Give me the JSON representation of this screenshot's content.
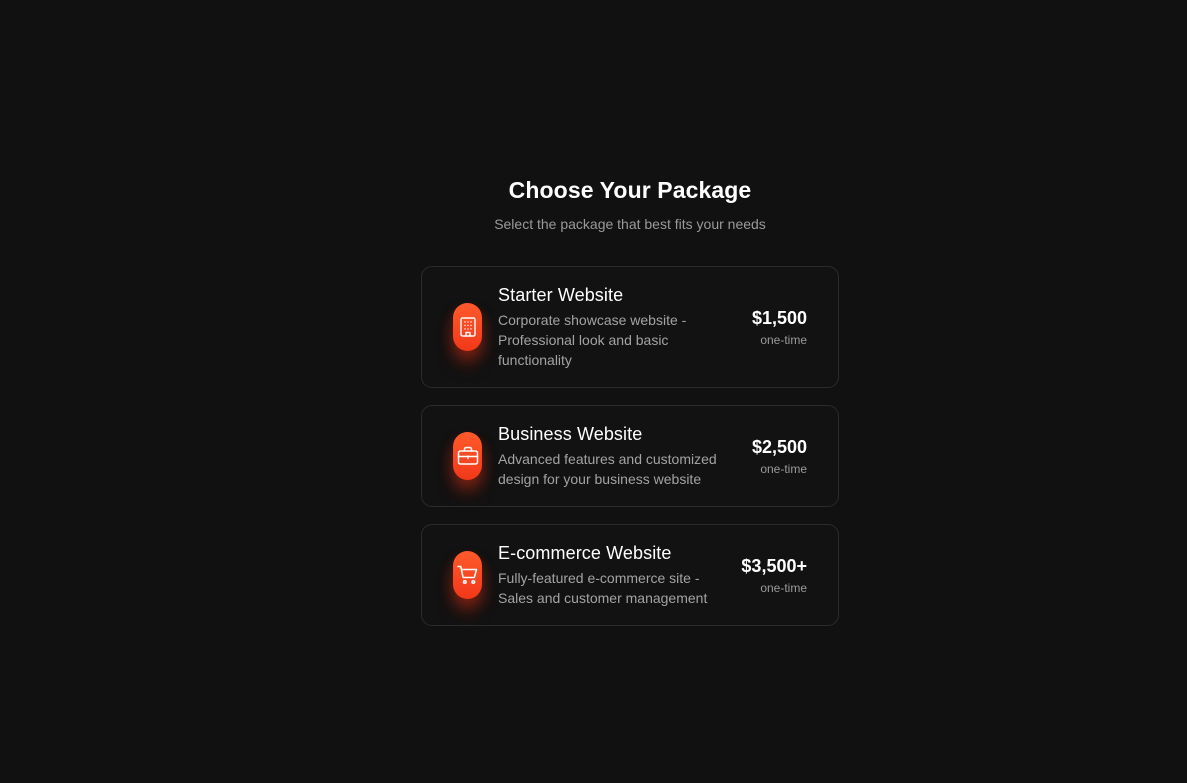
{
  "header": {
    "title": "Choose Your Package",
    "subtitle": "Select the package that best fits your needs"
  },
  "packages": [
    {
      "icon": "building-icon",
      "name": "Starter Website",
      "description": "Corporate showcase website - Professional look and basic functionality",
      "price": "$1,500",
      "period": "one-time"
    },
    {
      "icon": "briefcase-icon",
      "name": "Business Website",
      "description": "Advanced features and customized design for your business website",
      "price": "$2,500",
      "period": "one-time"
    },
    {
      "icon": "shopping-cart-icon",
      "name": "E-commerce Website",
      "description": "Fully-featured e-commerce site - Sales and customer management",
      "price": "$3,500+",
      "period": "one-time"
    }
  ],
  "colors": {
    "background": "#111111",
    "card_border": "#2b2b2b",
    "accent": "#f2381a",
    "muted_text": "#a3a3a3"
  }
}
